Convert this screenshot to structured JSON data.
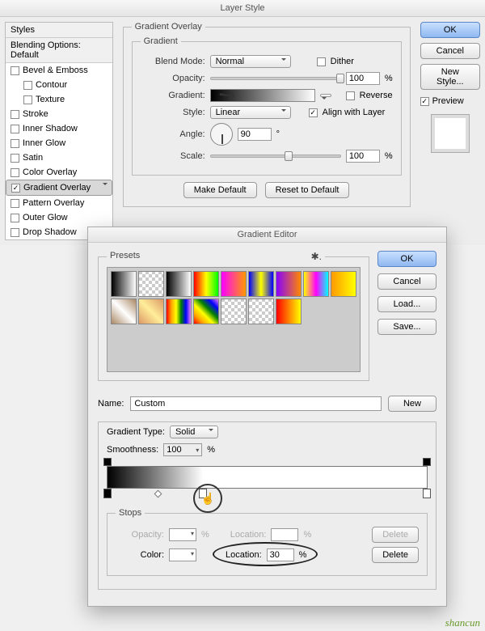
{
  "layer_style": {
    "title": "Layer Style",
    "styles_header": "Styles",
    "blending_options": "Blending Options: Default",
    "effects": [
      {
        "label": "Bevel & Emboss",
        "checked": false
      },
      {
        "label": "Contour",
        "checked": false,
        "sub": true
      },
      {
        "label": "Texture",
        "checked": false,
        "sub": true
      },
      {
        "label": "Stroke",
        "checked": false
      },
      {
        "label": "Inner Shadow",
        "checked": false
      },
      {
        "label": "Inner Glow",
        "checked": false
      },
      {
        "label": "Satin",
        "checked": false
      },
      {
        "label": "Color Overlay",
        "checked": false
      },
      {
        "label": "Gradient Overlay",
        "checked": true,
        "selected": true
      },
      {
        "label": "Pattern Overlay",
        "checked": false
      },
      {
        "label": "Outer Glow",
        "checked": false
      },
      {
        "label": "Drop Shadow",
        "checked": false
      }
    ],
    "gradient_overlay": {
      "group_label": "Gradient Overlay",
      "inner_label": "Gradient",
      "blend_mode_label": "Blend Mode:",
      "blend_mode": "Normal",
      "dither_label": "Dither",
      "opacity_label": "Opacity:",
      "opacity": "100",
      "pct": "%",
      "gradient_label": "Gradient:",
      "reverse_label": "Reverse",
      "style_label": "Style:",
      "style": "Linear",
      "align_label": "Align with Layer",
      "angle_label": "Angle:",
      "angle": "90",
      "deg": "°",
      "scale_label": "Scale:",
      "scale": "100",
      "make_default": "Make Default",
      "reset_default": "Reset to Default"
    },
    "buttons": {
      "ok": "OK",
      "cancel": "Cancel",
      "new_style": "New Style...",
      "preview": "Preview"
    }
  },
  "gradient_editor": {
    "title": "Gradient Editor",
    "presets_label": "Presets",
    "buttons": {
      "ok": "OK",
      "cancel": "Cancel",
      "load": "Load...",
      "save": "Save...",
      "new": "New",
      "delete": "Delete"
    },
    "name_label": "Name:",
    "name": "Custom",
    "gradient_type_label": "Gradient Type:",
    "gradient_type": "Solid",
    "smoothness_label": "Smoothness:",
    "smoothness": "100",
    "pct": "%",
    "stops": {
      "group_label": "Stops",
      "opacity_label": "Opacity:",
      "opacity": "",
      "opacity_location_label": "Location:",
      "opacity_location": "",
      "color_label": "Color:",
      "color_location_label": "Location:",
      "color_location": "30"
    },
    "preset_gradients": [
      "linear-gradient(to right,#000,#fff)",
      "repeating-conic-gradient(#ccc 0 25%,#fff 0 50%) 0/8px 8px",
      "linear-gradient(to right,#000,#fff)",
      "linear-gradient(to right,#f00,#ff0,#0f0)",
      "linear-gradient(to right,#f0f,#f90)",
      "linear-gradient(to right,#00f,#ff0,#00f)",
      "linear-gradient(to right,#80f,#f80)",
      "linear-gradient(to right,#ff0,#f0f,#0ff)",
      "linear-gradient(to right,#f90,#ff0)",
      "linear-gradient(45deg,#a86,#fff,#a86)",
      "linear-gradient(45deg,#d96,#fe9,#d96)",
      "linear-gradient(to right,red,orange,yellow,green,blue,violet)",
      "linear-gradient(45deg,red,orange,yellow,green,blue,violet)",
      "repeating-conic-gradient(#ccc 0 25%,#fff 0 50%) 0/8px 8px",
      "repeating-conic-gradient(#ccc 0 25%,#fff 0 50%) 0/8px 8px",
      "linear-gradient(to right,#f00,#ff0)"
    ]
  },
  "watermark": "shancun"
}
